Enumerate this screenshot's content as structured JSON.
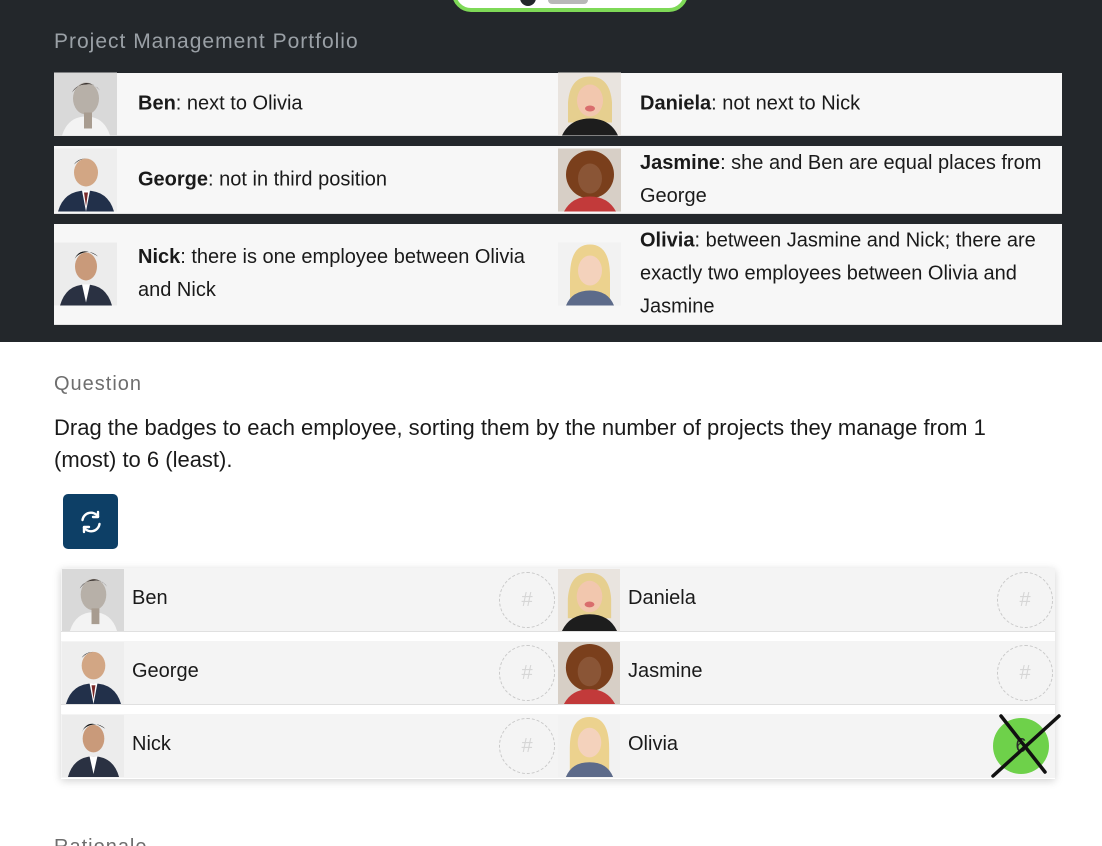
{
  "portfolio": {
    "title": "Project Management Portfolio",
    "clues": [
      {
        "name": "Ben",
        "text": ": next to Olivia"
      },
      {
        "name": "Daniela",
        "text": ": not next to Nick"
      },
      {
        "name": "George",
        "text": ": not in third position"
      },
      {
        "name": "Jasmine",
        "text": ": she and Ben are equal places from George"
      },
      {
        "name": "Nick",
        "text": ": there is one employee between Olivia and Nick"
      },
      {
        "name": "Olivia",
        "text": ": between Jasmine and Nick; there are exactly two employees between Olivia and Jasmine"
      }
    ]
  },
  "question": {
    "heading": "Question",
    "text": "Drag the badges to each employee, sorting them by the number of projects they manage from 1 (most) to 6 (least).",
    "refresh_icon": "refresh-icon",
    "employees": [
      {
        "name": "Ben",
        "badge": "#",
        "placed": false
      },
      {
        "name": "Daniela",
        "badge": "#",
        "placed": false
      },
      {
        "name": "George",
        "badge": "#",
        "placed": false
      },
      {
        "name": "Jasmine",
        "badge": "#",
        "placed": false
      },
      {
        "name": "Nick",
        "badge": "#",
        "placed": false
      },
      {
        "name": "Olivia",
        "badge": "6",
        "placed": true,
        "incorrect": true
      }
    ]
  },
  "next_section": {
    "heading": "Rationale"
  },
  "colors": {
    "dark_panel": "#23272b",
    "accent_green": "#6ed14a",
    "button_blue": "#0d3f66"
  }
}
